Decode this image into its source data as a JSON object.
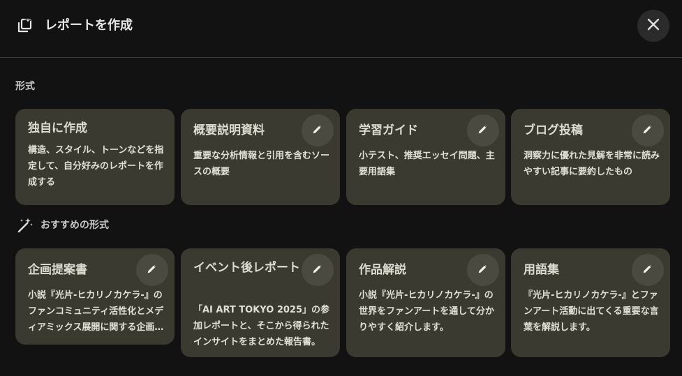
{
  "header": {
    "title": "レポートを作成",
    "icon": "report-sparkle-icon",
    "close_icon": "close-icon"
  },
  "sections": {
    "format_label": "形式",
    "recommended_label": "おすすめの形式",
    "recommended_icon": "magic-wand-icon"
  },
  "format_cards": [
    {
      "title": "独自に作成",
      "desc": "構造、スタイル、トーンなどを指定して、自分好みのレポートを作成する"
    },
    {
      "title": "概要説明資料",
      "desc": "重要な分析情報と引用を含むソースの概要"
    },
    {
      "title": "学習ガイド",
      "desc": "小テスト、推奨エッセイ問題、主要用語集"
    },
    {
      "title": "ブログ投稿",
      "desc": "洞察力に優れた見解を非常に読みやすい記事に要約したもの"
    }
  ],
  "recommended_cards": [
    {
      "title": "企画提案書",
      "desc": "小説『光片-ヒカリノカケラ-』のファンコミュニティ活性化とメディアミックス展開に関する企画提案書"
    },
    {
      "title": "イベント後レポート",
      "desc": "「AI ART TOKYO 2025」の参加レポートと、そこから得られたインサイトをまとめた報告書。"
    },
    {
      "title": "作品解説",
      "desc": "小説『光片-ヒカリノカケラ-』の世界をファンアートを通して分かりやすく紹介します。"
    },
    {
      "title": "用語集",
      "desc": "『光片-ヒカリノカケラ-』とファンアート活動に出てくる重要な言葉を解説します。"
    }
  ],
  "colors": {
    "background": "#121212",
    "card": "#3a3a30",
    "edit_button": "#4a4a40",
    "close_button": "#2b2b2b"
  }
}
